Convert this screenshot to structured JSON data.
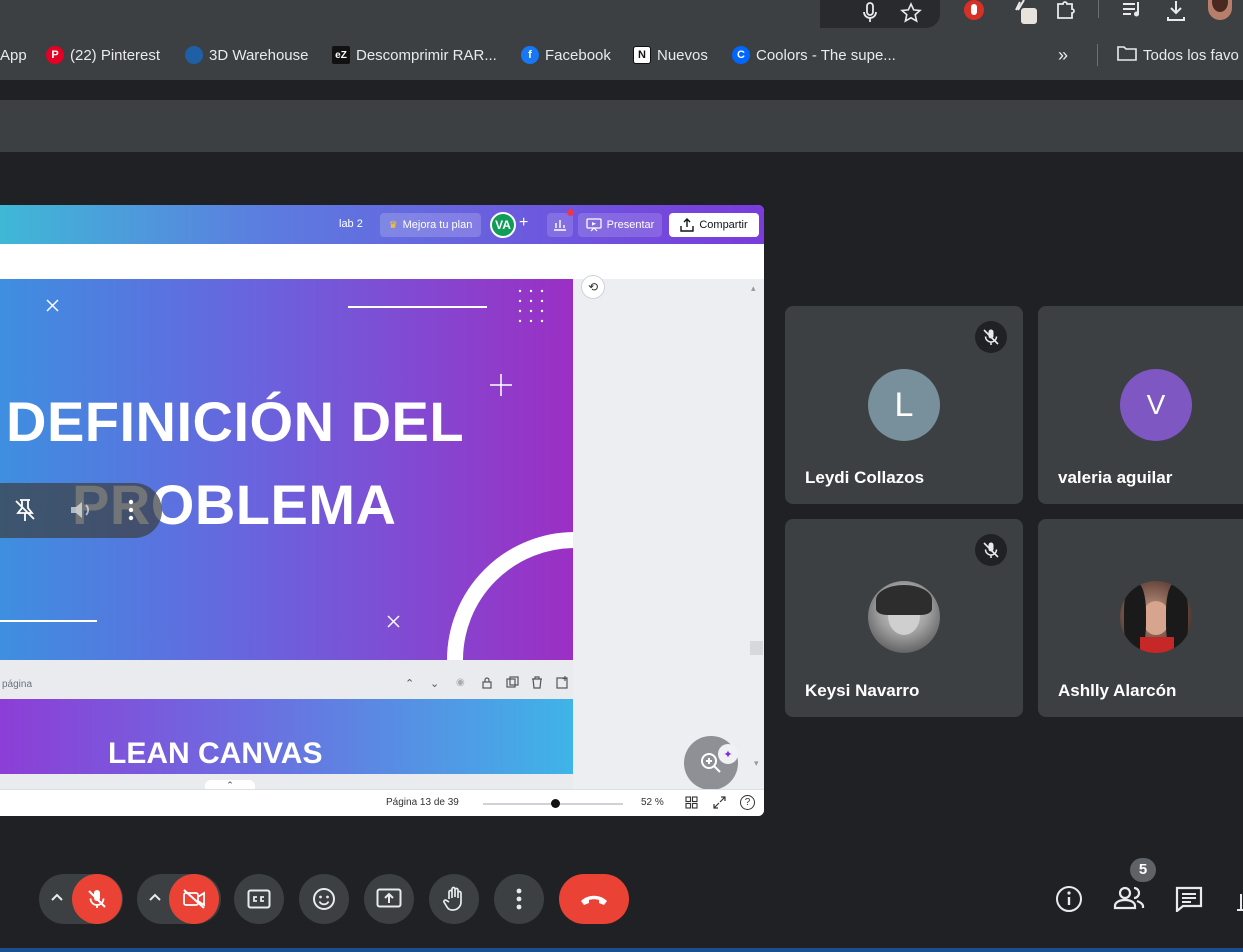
{
  "bookmarks": [
    {
      "label": "App",
      "icon": "grid-icon"
    },
    {
      "label": "(22) Pinterest",
      "icon": "pinterest-icon",
      "color": "#e60023"
    },
    {
      "label": "3D Warehouse",
      "icon": "3d-warehouse-icon",
      "color": "#1f5fa6"
    },
    {
      "label": "Descomprimir RAR...",
      "icon": "ez-icon",
      "color": "#111111"
    },
    {
      "label": "Facebook",
      "icon": "facebook-icon",
      "color": "#1877f2"
    },
    {
      "label": "Nuevos",
      "icon": "notion-icon",
      "color": "#ffffff"
    },
    {
      "label": "Coolors - The supe...",
      "icon": "coolors-icon",
      "color": "#0066ff"
    }
  ],
  "bookmarks_overflow": "»",
  "bookmarks_folder": "Todos los favo",
  "canva": {
    "file_name_fragment": "lab 2",
    "upgrade_label": "Mejora tu plan",
    "user_initials": "VA",
    "present_label": "Presentar",
    "share_label": "Compartir",
    "slide1_title_line1": "DEFINICIÓN DEL",
    "slide1_title_line2": "PROBLEMA",
    "page_title_placeholder": "página",
    "slide2_title": "LEAN CANVAS",
    "page_indicator": "Página 13 de 39",
    "zoom_level": "52 %",
    "zoom_fraction": 0.52,
    "help_label": "?"
  },
  "participants": [
    {
      "name": "Leydi Collazos",
      "initial": "L",
      "avatar_color": "#78909c",
      "muted": true
    },
    {
      "name": "valeria aguilar",
      "initial": "V",
      "avatar_color": "#7e57c2",
      "muted": true
    },
    {
      "name": "Keysi Navarro",
      "initial": "",
      "avatar_color": "#9e9e9e",
      "muted": true
    },
    {
      "name": "Ashlly Alarcón",
      "initial": "",
      "avatar_color": "#5d4037",
      "muted": true
    }
  ],
  "participants_count": "5",
  "colors": {
    "meet_bg": "#202124",
    "tile_bg": "#3c4043",
    "danger": "#ea4335",
    "canva_purple": "#7d2ae8"
  }
}
